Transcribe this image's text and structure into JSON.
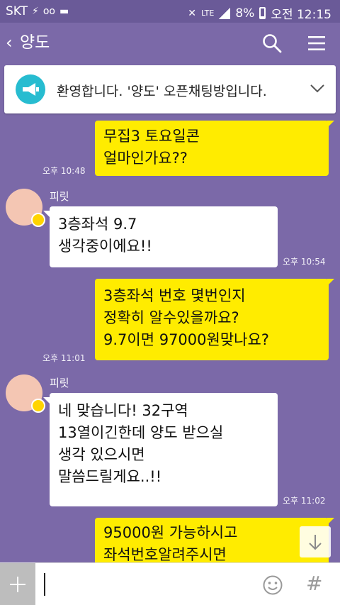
{
  "status_bar": {
    "carrier": "SKT",
    "lte": "LTE",
    "battery": "8%",
    "clock": "오전 12:15"
  },
  "header": {
    "back_icon": "chevron-left-icon",
    "title": "양도",
    "search_icon": "search-icon",
    "menu_icon": "hamburger-menu-icon"
  },
  "notice": {
    "icon": "megaphone-icon",
    "text": "환영합니다. '양도' 오픈채팅방입니다.",
    "expand_icon": "chevron-down-icon"
  },
  "messages": [
    {
      "from": "me",
      "lines": [
        "무집3  토요일콘",
        "얼마인가요??"
      ],
      "time": "오후 10:48"
    },
    {
      "from": "other",
      "sender": "피릿",
      "lines": [
        "3층좌석 9.7",
        "생각중이에요!!"
      ],
      "time": "오후 10:54"
    },
    {
      "from": "me",
      "lines": [
        "3층좌석 번호 몇번인지",
        "정확히 알수있을까요?",
        "9.7이면 97000원맞나요?"
      ],
      "time": "오후 11:01"
    },
    {
      "from": "other",
      "sender": "피릿",
      "lines": [
        "네 맞습니다! 32구역",
        "13열이긴한데 양도 받으실",
        "생각 있으시면",
        "말씀드릴게요..!!"
      ],
      "time": "오후 11:02"
    },
    {
      "from": "me",
      "lines": [
        "95000원 가능하시고",
        "좌석번호알려주시면"
      ],
      "time": ""
    }
  ],
  "input_bar": {
    "placeholder": "",
    "plus_icon": "plus-icon",
    "emoji_icon": "emoticon-icon",
    "hash_label": "#"
  },
  "colors": {
    "background": "#7b69a8",
    "my_bubble": "#ffec00",
    "other_bubble": "#ffffff",
    "notice_icon": "#27bcd0"
  }
}
